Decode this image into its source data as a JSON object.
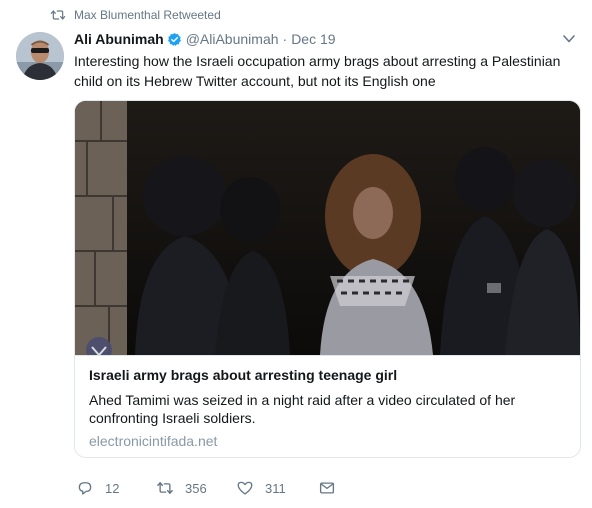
{
  "retweet_context": {
    "text": "Max Blumenthal Retweeted",
    "icon": "retweet-icon"
  },
  "tweet": {
    "author": {
      "display_name": "Ali Abunimah",
      "verified": true,
      "handle": "@AliAbunimah",
      "separator": "·",
      "date": "Dec 19"
    },
    "text": "Interesting how the Israeli occupation army brags about arresting a Palestinian child on its Hebrew Twitter account, but not its English one",
    "card": {
      "title": "Israeli army brags about arresting teenage girl",
      "description": "Ahed Tamimi was seized in a night raid after a video circulated of her confronting Israeli soldiers.",
      "domain": "electronicintifada.net",
      "image_icon": "news-photo"
    },
    "actions": {
      "replies": "12",
      "retweets": "356",
      "likes": "311",
      "icons": [
        "reply-icon",
        "retweet-icon",
        "like-icon",
        "direct-message-icon"
      ]
    }
  },
  "colors": {
    "text_primary": "#14171a",
    "text_secondary": "#657786",
    "verified_blue": "#1da1f2",
    "border": "#e1e8ed",
    "domain": "#8899a6"
  }
}
